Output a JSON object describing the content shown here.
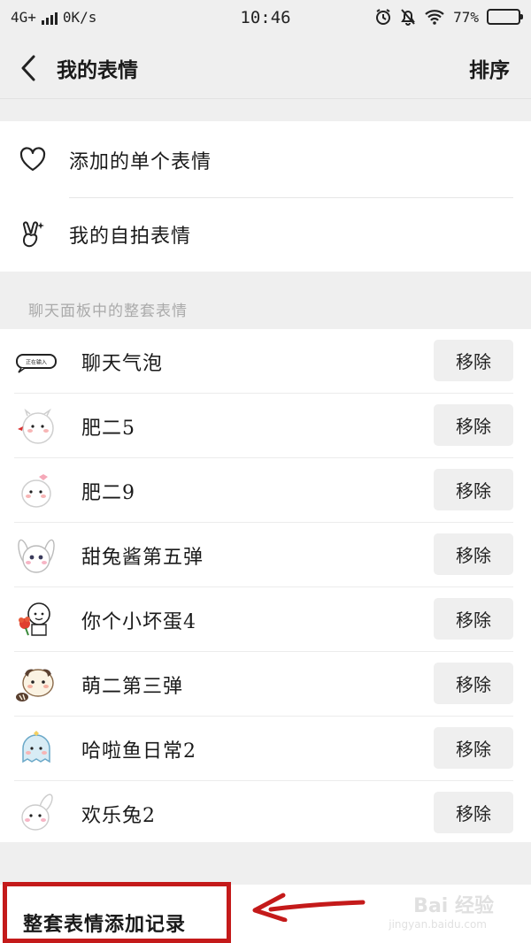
{
  "status_bar": {
    "network": "4G+",
    "speed": "0K/s",
    "time": "10:46",
    "battery_percent": "77%",
    "battery_level": 0.77
  },
  "navbar": {
    "back_icon": "chevron-left-icon",
    "title": "我的表情",
    "sort_label": "排序"
  },
  "top_items": [
    {
      "icon": "heart-icon",
      "label": "添加的单个表情"
    },
    {
      "icon": "victory-hand-icon",
      "label": "我的自拍表情"
    }
  ],
  "section_title": "聊天面板中的整套表情",
  "packs": [
    {
      "name": "聊天气泡",
      "thumb": "chat-bubble-sticker",
      "thumb_text": "正在输入",
      "action": "移除"
    },
    {
      "name": "肥二5",
      "thumb": "chubby-sticker",
      "action": "移除"
    },
    {
      "name": "肥二9",
      "thumb": "chubby-bow-sticker",
      "action": "移除"
    },
    {
      "name": "甜兔酱第五弹",
      "thumb": "bunny-sticker",
      "action": "移除"
    },
    {
      "name": "你个小坏蛋4",
      "thumb": "kid-flower-sticker",
      "action": "移除"
    },
    {
      "name": "萌二第三弹",
      "thumb": "raccoon-sticker",
      "action": "移除"
    },
    {
      "name": "哈啦鱼日常2",
      "thumb": "fish-sticker",
      "action": "移除"
    },
    {
      "name": "欢乐兔2",
      "thumb": "happy-bunny-sticker",
      "action": "移除"
    }
  ],
  "history": {
    "label": "整套表情添加记录"
  },
  "watermark": {
    "brand": "Bai 经验",
    "url": "jingyan.baidu.com"
  },
  "colors": {
    "highlight": "#c41a1a",
    "background": "#efefef",
    "button_bg": "#efefef"
  }
}
